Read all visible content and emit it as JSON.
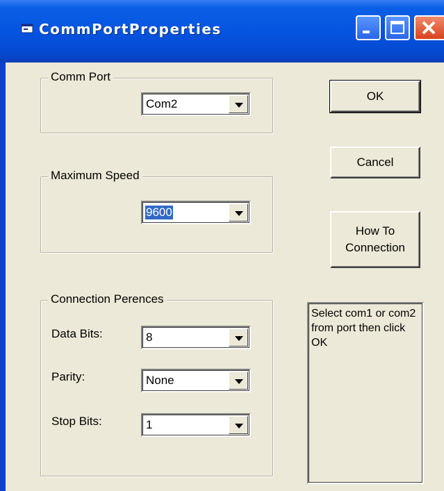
{
  "window": {
    "title": "CommPortProperties",
    "title_icon": "app-window-icon",
    "controls": [
      "minimize-icon",
      "maximize-icon",
      "close-icon"
    ]
  },
  "comm_port": {
    "group_title": "Comm Port",
    "selected": "Com2"
  },
  "max_speed": {
    "group_title": "Maximum Speed",
    "selected": "9600"
  },
  "connection": {
    "group_title": "Connection Perences",
    "data_bits_label": "Data Bits:",
    "data_bits_value": "8",
    "parity_label": "Parity:",
    "parity_value": "None",
    "stop_bits_label": "Stop Bits:",
    "stop_bits_value": "1"
  },
  "buttons": {
    "ok": "OK",
    "cancel": "Cancel",
    "how_to_line1": "How To",
    "how_to_line2": "Connection"
  },
  "info": {
    "text": "Select com1 or com2 from port then click OK"
  },
  "colors": {
    "titlebar": "#0654e0",
    "dialog_bg": "#ece9d8",
    "selection": "#316ac5"
  }
}
